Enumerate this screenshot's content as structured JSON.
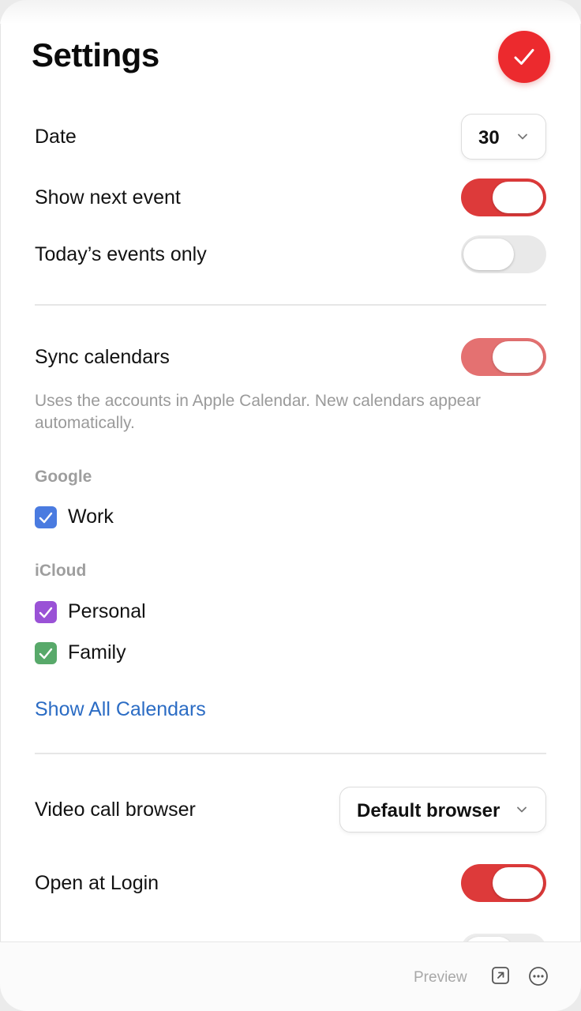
{
  "header": {
    "title": "Settings"
  },
  "general": {
    "date": {
      "label": "Date",
      "value": "30"
    },
    "show_next_event": {
      "label": "Show next event",
      "on": true
    },
    "todays_events_only": {
      "label": "Today’s events only",
      "on": false
    }
  },
  "calendars": {
    "sync": {
      "label": "Sync calendars",
      "on": true
    },
    "help_text": "Uses the accounts in Apple Calendar. New calendars appear automatically.",
    "groups": [
      {
        "name": "Google",
        "items": [
          {
            "label": "Work",
            "color": "#4a7be0",
            "checked": true
          }
        ]
      },
      {
        "name": "iCloud",
        "items": [
          {
            "label": "Personal",
            "color": "#9a52d6",
            "checked": true
          },
          {
            "label": "Family",
            "color": "#58a96a",
            "checked": true
          }
        ]
      }
    ],
    "show_all_link": "Show All Calendars"
  },
  "other": {
    "video_call_browser": {
      "label": "Video call browser",
      "value": "Default browser"
    },
    "open_at_login": {
      "label": "Open at Login",
      "on": true
    }
  },
  "footer": {
    "preview": "Preview"
  },
  "colors": {
    "accent": "#ec2a2e",
    "toggle_on": "#dd3a3a",
    "link": "#2b6cc4"
  }
}
